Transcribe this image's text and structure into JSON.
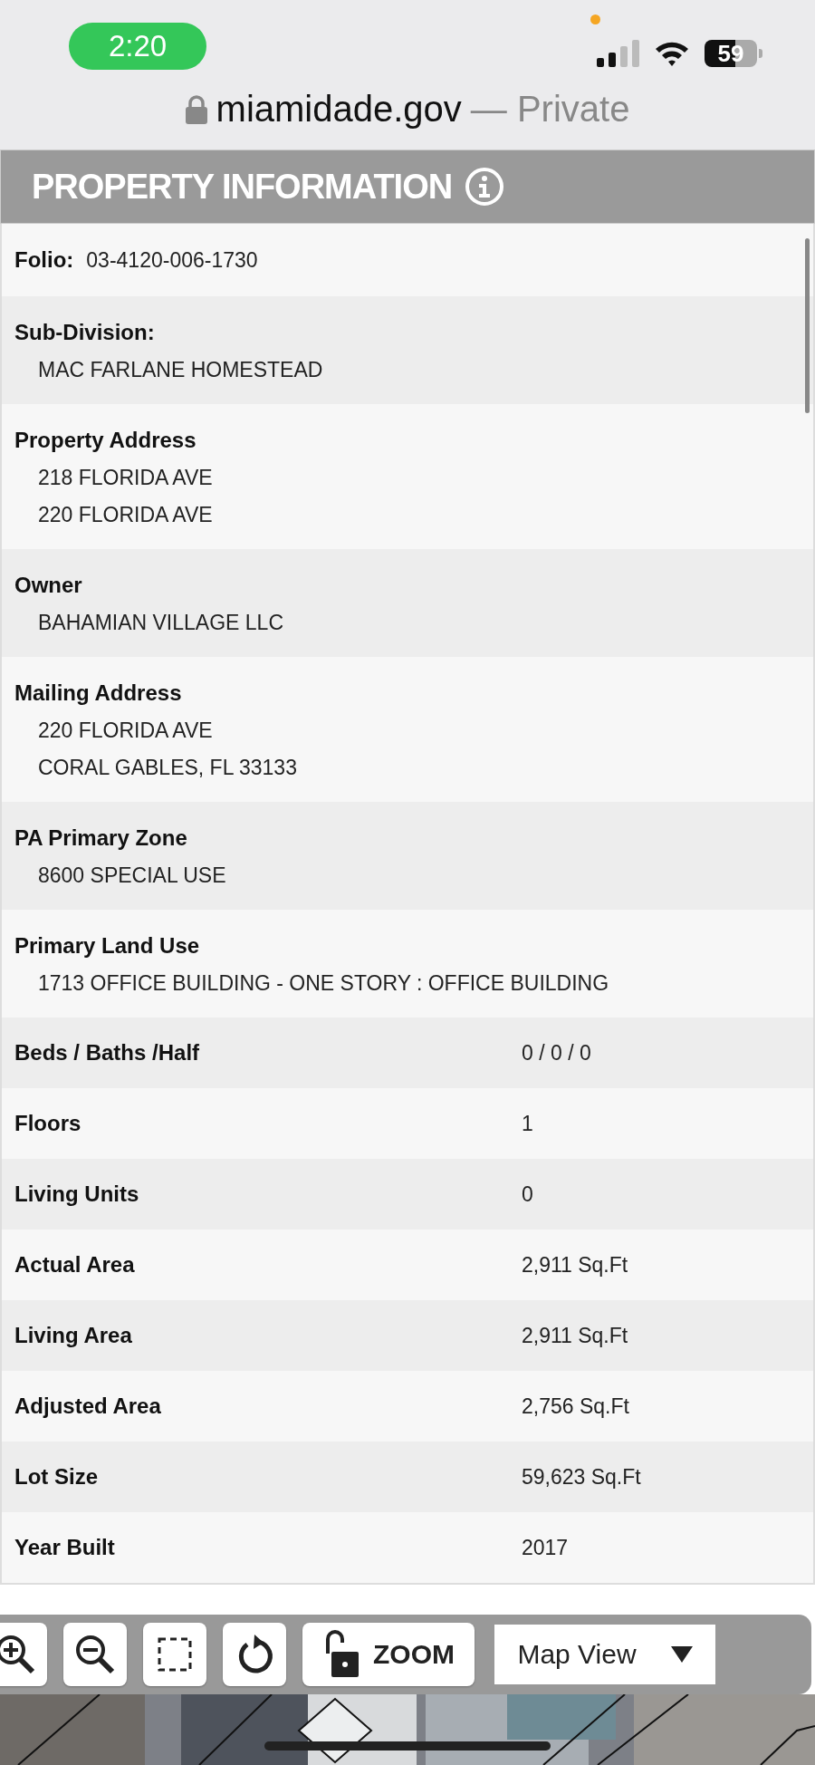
{
  "status_bar": {
    "time": "2:20",
    "battery": "59"
  },
  "browser": {
    "domain": "miamidade.gov",
    "suffix": "— Private"
  },
  "panel": {
    "title": "PROPERTY INFORMATION",
    "rows": [
      {
        "kind": "inline",
        "label": "Folio:",
        "values": [
          "03-4120-006-1730"
        ]
      },
      {
        "kind": "block",
        "label": "Sub-Division:",
        "values": [
          "MAC FARLANE HOMESTEAD"
        ]
      },
      {
        "kind": "block",
        "label": "Property Address",
        "values": [
          "218 FLORIDA AVE",
          "220 FLORIDA AVE"
        ]
      },
      {
        "kind": "block",
        "label": "Owner",
        "values": [
          "BAHAMIAN VILLAGE LLC"
        ]
      },
      {
        "kind": "block",
        "label": "Mailing Address",
        "values": [
          "220 FLORIDA AVE",
          "CORAL GABLES, FL 33133"
        ]
      },
      {
        "kind": "block",
        "label": "PA Primary Zone",
        "values": [
          "8600 SPECIAL USE"
        ]
      },
      {
        "kind": "block",
        "label": "Primary Land Use",
        "values": [
          "1713 OFFICE BUILDING - ONE STORY : OFFICE BUILDING"
        ]
      },
      {
        "kind": "pair",
        "label": "Beds / Baths /Half",
        "values": [
          "0 / 0 / 0"
        ]
      },
      {
        "kind": "pair",
        "label": "Floors",
        "values": [
          "1"
        ]
      },
      {
        "kind": "pair",
        "label": "Living Units",
        "values": [
          "0"
        ]
      },
      {
        "kind": "pair",
        "label": "Actual Area",
        "values": [
          "2,911 Sq.Ft"
        ]
      },
      {
        "kind": "pair",
        "label": "Living Area",
        "values": [
          "2,911 Sq.Ft"
        ]
      },
      {
        "kind": "pair",
        "label": "Adjusted Area",
        "values": [
          "2,756 Sq.Ft"
        ]
      },
      {
        "kind": "pair",
        "label": "Lot Size",
        "values": [
          "59,623 Sq.Ft"
        ]
      },
      {
        "kind": "pair",
        "label": "Year Built",
        "values": [
          "2017"
        ]
      }
    ]
  },
  "toolbar": {
    "zoom_label": "ZOOM",
    "view_select": "Map View"
  }
}
